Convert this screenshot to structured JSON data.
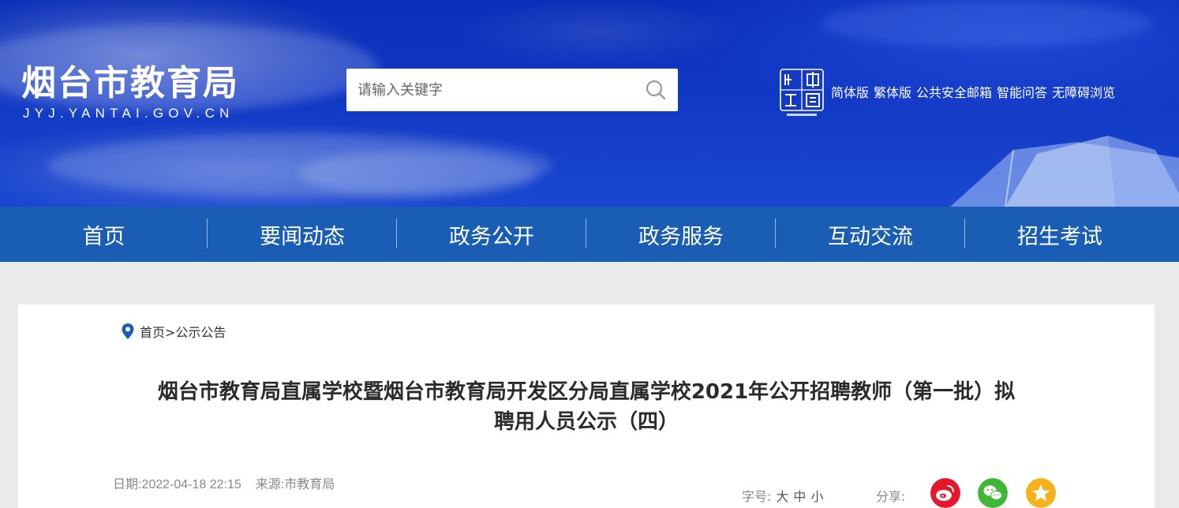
{
  "header": {
    "site_title": "烟台市教育局",
    "site_url": "JYJ.YANTAI.GOV.CN",
    "search_placeholder": "请输入关键字",
    "top_links": [
      "简体版",
      "繁体版",
      "公共安全邮箱",
      "智能问答",
      "无障碍浏览"
    ]
  },
  "nav": {
    "items": [
      "首页",
      "要闻动态",
      "政务公开",
      "政务服务",
      "互动交流",
      "招生考试"
    ]
  },
  "breadcrumb": {
    "home": "首页",
    "separator": ">",
    "section": "公示公告"
  },
  "article": {
    "title_line1": "烟台市教育局直属学校暨烟台市教育局开发区分局直属学校2021年公开招聘教师（第一批）拟",
    "title_line2": "聘用人员公示（四）",
    "date": "日期:2022-04-18 22:15",
    "source": "来源:市教育局"
  },
  "tools": {
    "fontsize_label": "字号:",
    "fontsize_options": [
      "大",
      "中",
      "小"
    ],
    "share_label": "分享:"
  },
  "colors": {
    "nav_bg": "#1a5db5",
    "banner_bg": "#1138c4",
    "weibo": "#e6162d",
    "wechat": "#3fb838",
    "favorite": "#f5b21b",
    "location_pin": "#1a5db5"
  },
  "icons": [
    "search-icon",
    "location-pin-icon",
    "weibo-icon",
    "wechat-icon",
    "star-icon"
  ]
}
